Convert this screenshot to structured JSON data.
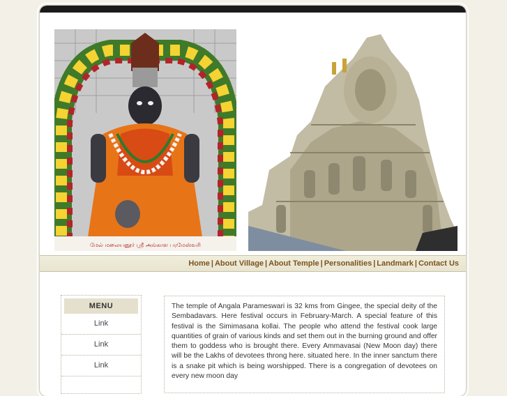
{
  "site": {
    "accent_color": "#7a5320",
    "background_color": "#f3f1e7"
  },
  "banner": {
    "left_image": {
      "name": "deity-photo",
      "caption": "மேல் மலையனூர் ஸ்ரீ அங்காள பரமேஸ்வரி"
    },
    "right_image": {
      "name": "temple-tower-photo"
    }
  },
  "nav": {
    "items": [
      {
        "label": "Home"
      },
      {
        "label": "About Village"
      },
      {
        "label": "About Temple"
      },
      {
        "label": "Personalities"
      },
      {
        "label": "Landmark"
      },
      {
        "label": "Contact Us"
      }
    ],
    "separator": "|"
  },
  "menu": {
    "title": "MENU",
    "links": [
      {
        "label": "Link"
      },
      {
        "label": "Link"
      },
      {
        "label": "Link"
      }
    ]
  },
  "content": {
    "paragraph": "The temple of Angala Parameswari is 32 kms from Gingee, the special deity of the Sembadavars. Here festival occurs in February-March. A special feature of this festival is the Simimasana kollai. The people who attend the festival cook large quantities of grain of various kinds and set them out in the burning ground and offer them to goddess who is brought there. Every Ammavasai (New Moon day) there will be the Lakhs of devotees throng here. situated here. In the inner sanctum there is a snake pit which is being worshipped. There is a congregation of devotees on every new moon day"
  }
}
